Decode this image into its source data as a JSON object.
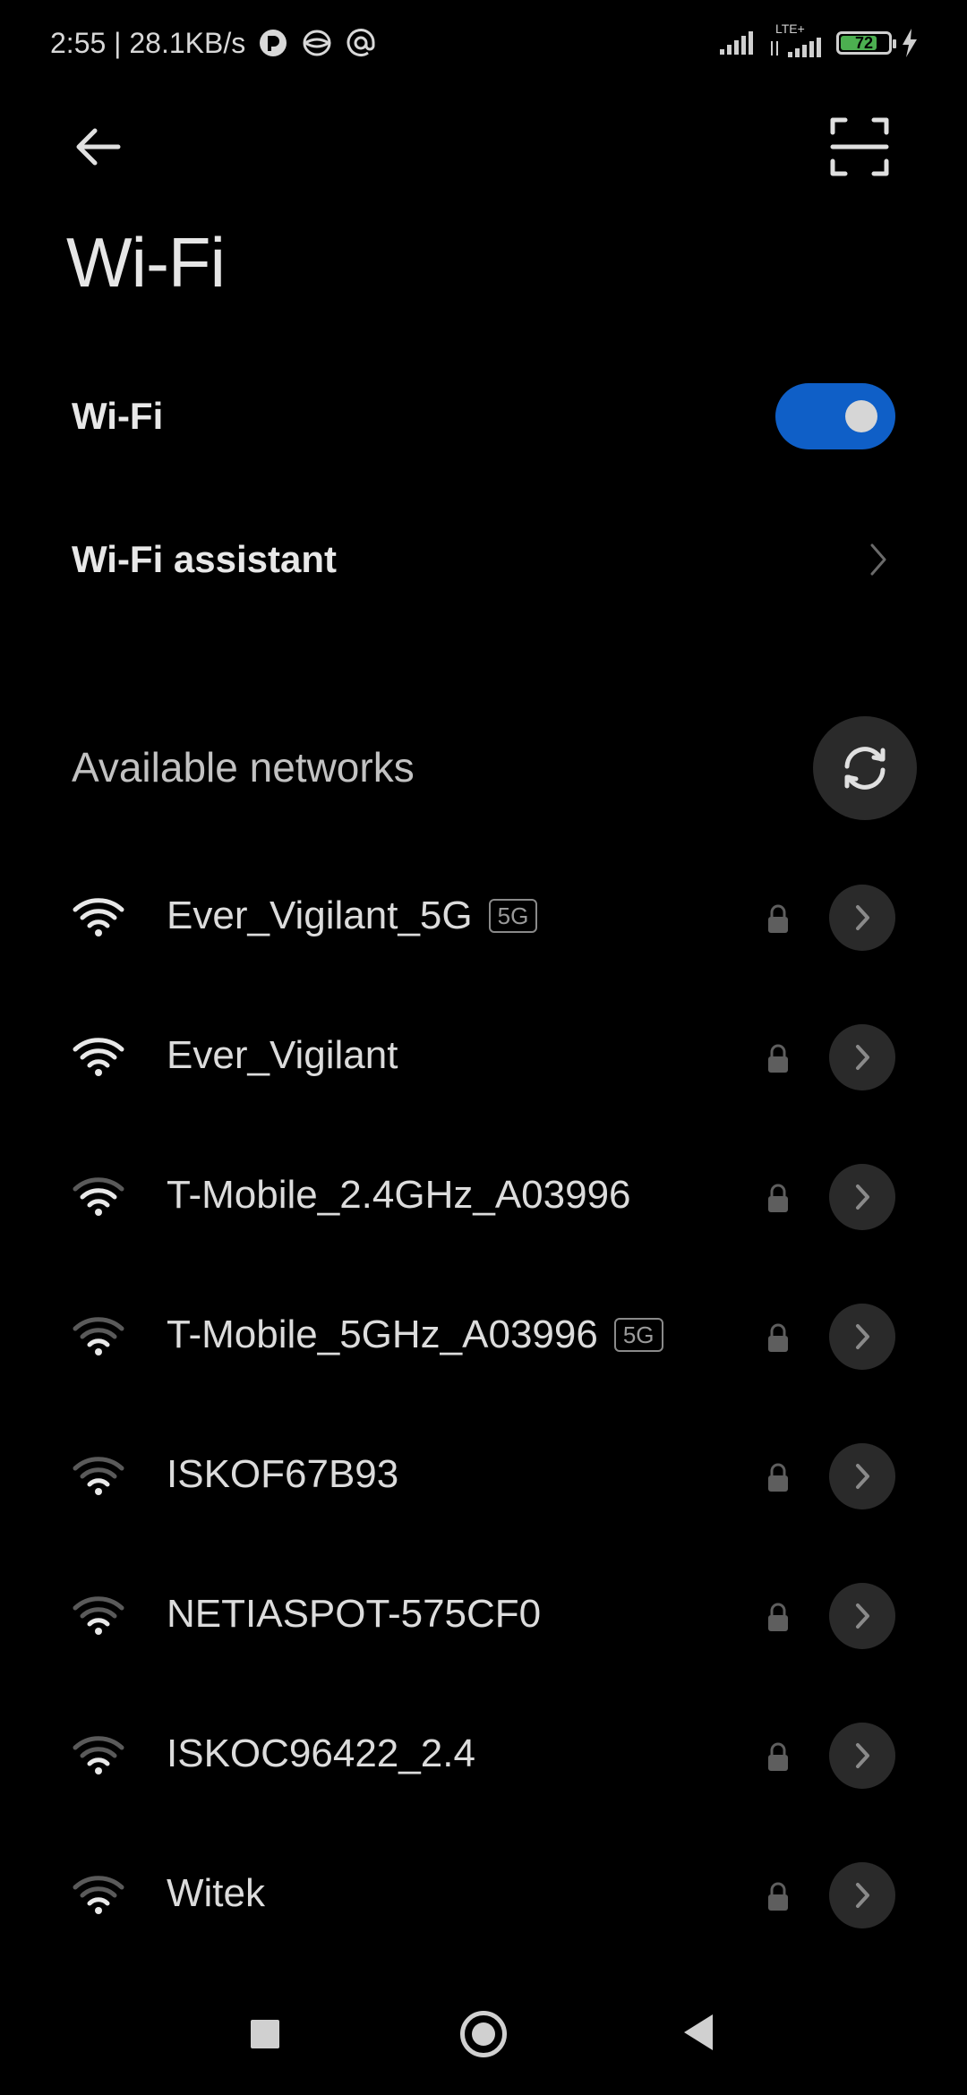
{
  "status_bar": {
    "time_speed": "2:55 | 28.1KB/s",
    "network_type": "LTE+",
    "battery_level": "72"
  },
  "header": {
    "title": "Wi-Fi"
  },
  "settings": {
    "wifi_label": "Wi-Fi",
    "wifi_enabled": true,
    "assistant_label": "Wi-Fi assistant"
  },
  "networks_section": {
    "header": "Available networks",
    "items": [
      {
        "ssid": "Ever_Vigilant_5G",
        "badge": "5G",
        "secured": true,
        "signal_bars": 4
      },
      {
        "ssid": "Ever_Vigilant",
        "badge": "",
        "secured": true,
        "signal_bars": 4
      },
      {
        "ssid": "T-Mobile_2.4GHz_A03996",
        "badge": "",
        "secured": true,
        "signal_bars": 3
      },
      {
        "ssid": "T-Mobile_5GHz_A03996",
        "badge": "5G",
        "secured": true,
        "signal_bars": 2
      },
      {
        "ssid": "ISKOF67B93",
        "badge": "",
        "secured": true,
        "signal_bars": 2
      },
      {
        "ssid": "NETIASPOT-575CF0",
        "badge": "",
        "secured": true,
        "signal_bars": 2
      },
      {
        "ssid": "ISKOC96422_2.4",
        "badge": "",
        "secured": true,
        "signal_bars": 2
      },
      {
        "ssid": "Witek",
        "badge": "",
        "secured": true,
        "signal_bars": 2
      }
    ]
  },
  "colors": {
    "accent": "#0f5fc7",
    "background": "#000000"
  }
}
